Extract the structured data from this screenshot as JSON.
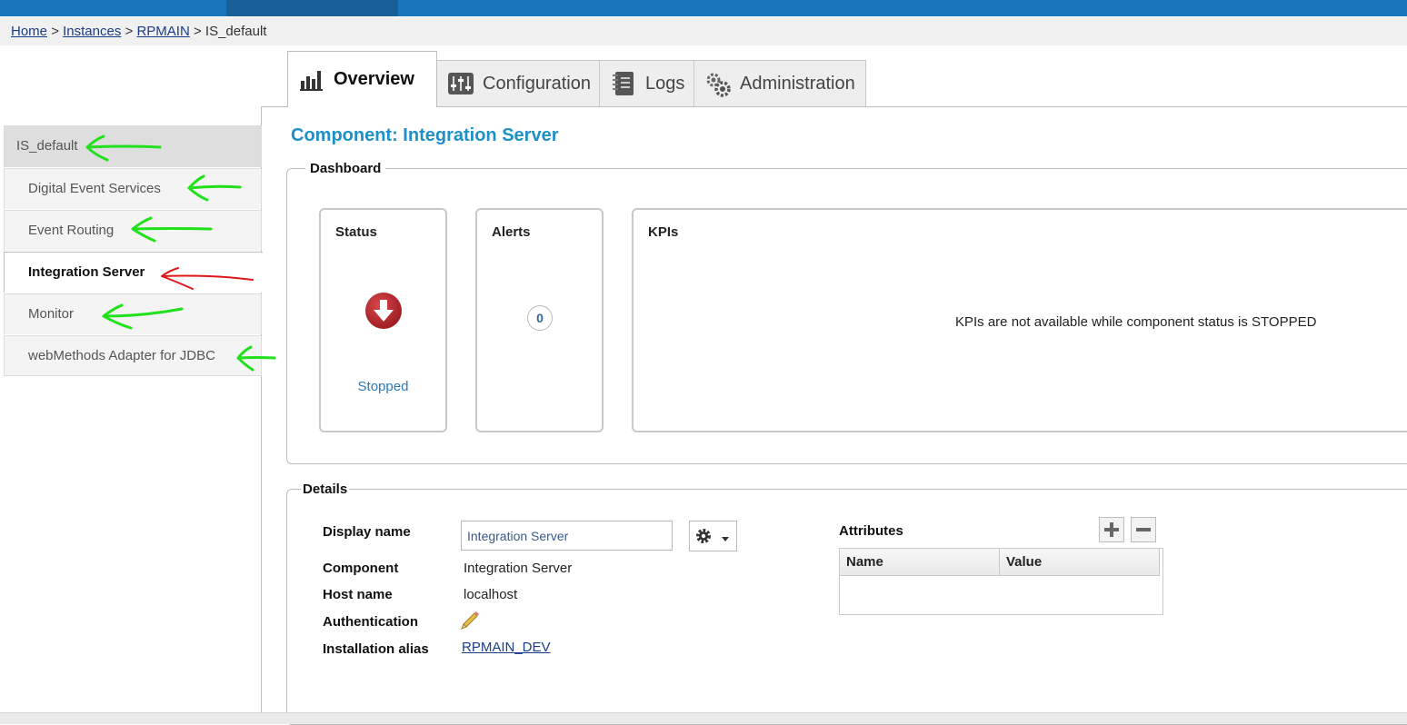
{
  "breadcrumb": {
    "home": "Home",
    "instances": "Instances",
    "rpmain": "RPMAIN",
    "current": "IS_default",
    "sep": ">"
  },
  "tabs": [
    {
      "label": "Overview",
      "icon": "bar-chart-icon",
      "active": true
    },
    {
      "label": "Configuration",
      "icon": "sliders-icon",
      "active": false
    },
    {
      "label": "Logs",
      "icon": "notebook-icon",
      "active": false
    },
    {
      "label": "Administration",
      "icon": "gears-icon",
      "active": false
    }
  ],
  "sidebar": {
    "items": [
      {
        "label": "IS_default"
      },
      {
        "label": "Digital Event Services"
      },
      {
        "label": "Event Routing"
      },
      {
        "label": "Integration Server"
      },
      {
        "label": "Monitor"
      },
      {
        "label": "webMethods Adapter for JDBC"
      }
    ]
  },
  "component_title": "Component: Integration Server",
  "dashboard": {
    "legend": "Dashboard",
    "status": {
      "title": "Status",
      "value": "Stopped",
      "icon": "stopped-down-arrow-icon",
      "color": "#b5272d"
    },
    "alerts": {
      "title": "Alerts",
      "count": "0"
    },
    "kpis": {
      "title": "KPIs",
      "message": "KPIs are not available while component status is STOPPED"
    }
  },
  "details": {
    "legend": "Details",
    "display_name_label": "Display name",
    "display_name_value": "Integration Server",
    "component_label": "Component",
    "component_value": "Integration Server",
    "host_label": "Host name",
    "host_value": "localhost",
    "auth_label": "Authentication",
    "alias_label": "Installation alias",
    "alias_value": "RPMAIN_DEV",
    "attributes": {
      "title": "Attributes",
      "columns": [
        "Name",
        "Value"
      ]
    }
  },
  "colors": {
    "accent": "#1e90c8",
    "topbar": "#1b75bc",
    "annotation_green": "#22e01c",
    "annotation_red": "#e01818"
  }
}
